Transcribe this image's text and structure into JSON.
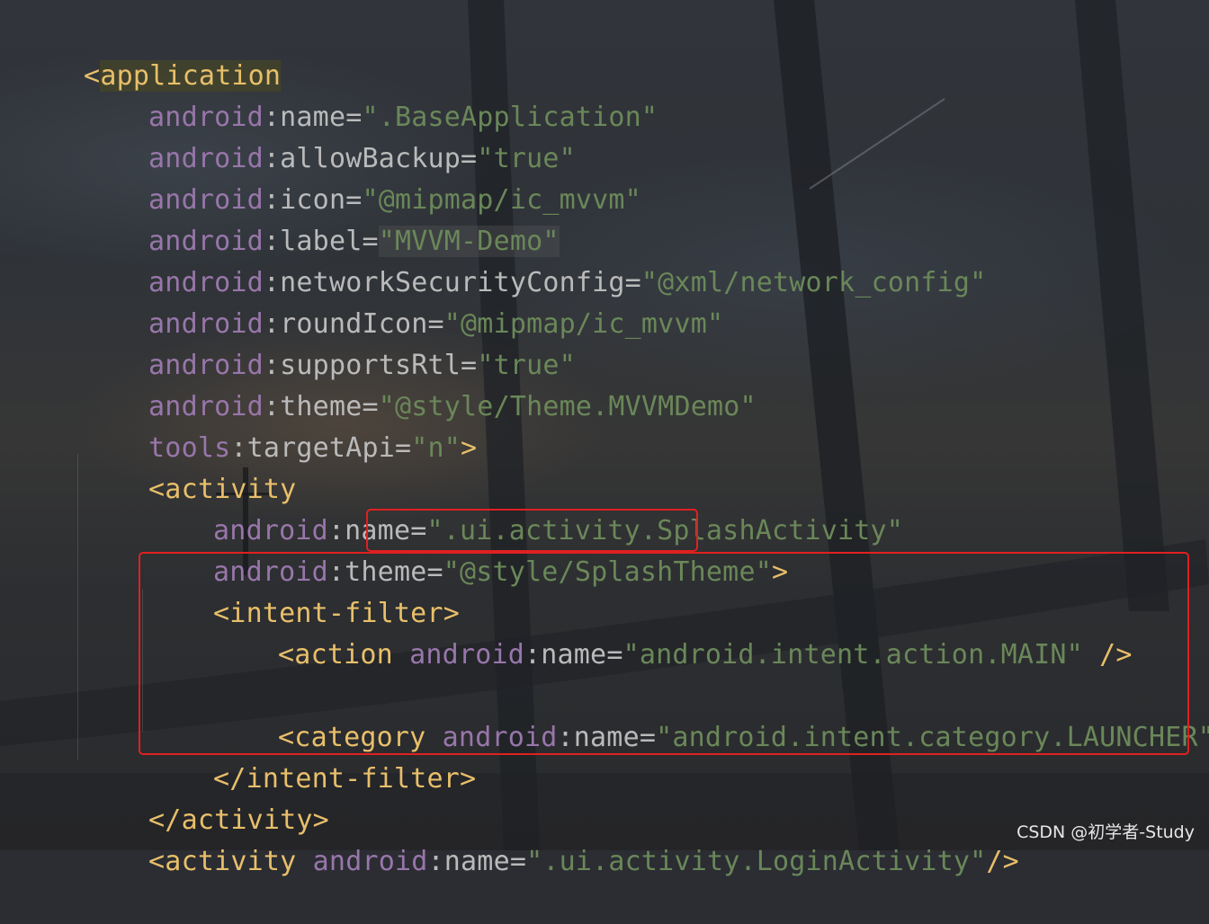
{
  "editor": {
    "language": "xml",
    "lines": [
      {
        "tag_open": "<",
        "tag_name": "application"
      },
      {
        "ns": "android",
        "attr": "name",
        "value": "\".BaseApplication\""
      },
      {
        "ns": "android",
        "attr": "allowBackup",
        "value": "\"true\""
      },
      {
        "ns": "android",
        "attr": "icon",
        "value": "\"@mipmap/ic_mvvm\""
      },
      {
        "ns": "android",
        "attr": "label",
        "value": "\"MVVM-Demo\""
      },
      {
        "ns": "android",
        "attr": "networkSecurityConfig",
        "value": "\"@xml/network_config\""
      },
      {
        "ns": "android",
        "attr": "roundIcon",
        "value": "\"@mipmap/ic_mvvm\""
      },
      {
        "ns": "android",
        "attr": "supportsRtl",
        "value": "\"true\""
      },
      {
        "ns": "android",
        "attr": "theme",
        "value": "\"@style/Theme.MVVMDemo\""
      },
      {
        "ns": "tools",
        "attr": "targetApi",
        "value": "\"n\"",
        "close": ">"
      },
      {
        "tag": "<activity"
      },
      {
        "ns": "android",
        "attr": "name",
        "value": "\".ui.activity.SplashActivity\""
      },
      {
        "ns": "android",
        "attr": "theme",
        "value": "\"@style/SplashTheme\"",
        "close": ">"
      },
      {
        "tag": "<intent-filter>"
      },
      {
        "tag": "<action",
        "ns": "android",
        "attr": "name",
        "value": "\"android.intent.action.MAIN\"",
        "close": " />"
      },
      {
        "blank": ""
      },
      {
        "tag": "<category",
        "ns": "android",
        "attr": "name",
        "value": "\"android.intent.category.LAUNCHER\"",
        "close": " />"
      },
      {
        "tag": "</intent-filter>"
      },
      {
        "tag": "</activity>"
      },
      {
        "tag": "<activity",
        "ns": "android",
        "attr": "name",
        "value": "\".ui.activity.LoginActivity\"",
        "close": "/>"
      }
    ],
    "separator_colon": ":",
    "separator_eq": "="
  },
  "watermark": "CSDN @初学者-Study",
  "colors": {
    "tag": "#e8bf6a",
    "namespace": "#9876aa",
    "attribute": "#bababa",
    "string": "#6a8759",
    "highlight_box": "#e02020"
  }
}
